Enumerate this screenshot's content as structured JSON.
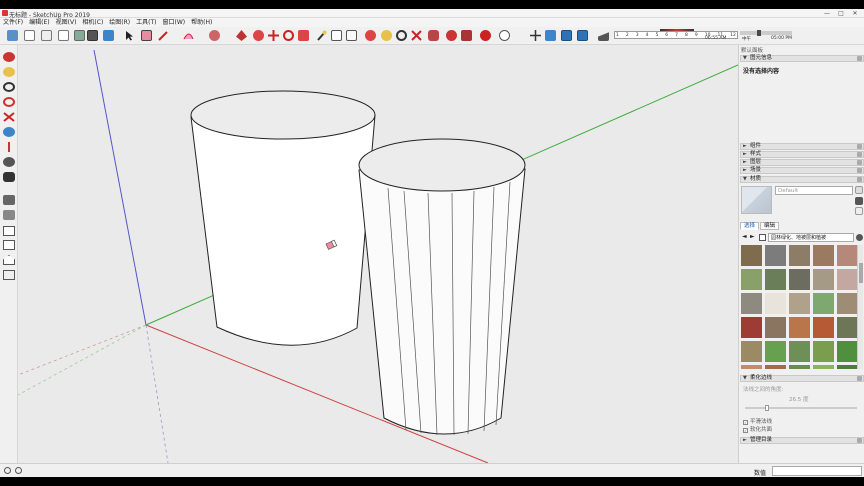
{
  "window": {
    "title": "无标题 - SketchUp Pro 2019",
    "controls": [
      "—",
      "□",
      "✕"
    ]
  },
  "menu": [
    "文件(F)",
    "编辑(E)",
    "视图(V)",
    "相机(C)",
    "绘图(R)",
    "工具(T)",
    "窗口(W)",
    "帮助(H)"
  ],
  "shadow_settings": {
    "months": [
      "1",
      "2",
      "3",
      "4",
      "5",
      "6",
      "7",
      "8",
      "9",
      "10",
      "11",
      "12"
    ],
    "time_start": "06:55 AM",
    "time_noon": "中午",
    "time_end": "05:00 PM"
  },
  "tray": {
    "title": "默认面板",
    "entity_info": {
      "header": "图元信息",
      "none_selected": "没有选择内容"
    },
    "sections": [
      "组件",
      "样式",
      "图层",
      "场景",
      "材质"
    ],
    "materials": {
      "name_placeholder": "Default",
      "tabs": [
        "选择",
        "编辑"
      ],
      "collection": "园林绿化、地被层和植被",
      "swatch_colors": [
        "#7f6b4e",
        "#7c7c7c",
        "#8e7d66",
        "#9b7a62",
        "#b5897a",
        "#8aa06a",
        "#6a7e59",
        "#6c6d60",
        "#a49a86",
        "#c4a7a0",
        "#8e8a80",
        "#e8e4dc",
        "#b0a28a",
        "#7da86f",
        "#9e8c74",
        "#9d3b34",
        "#8a7660",
        "#b8764a",
        "#b55a34",
        "#6d7657",
        "#9b8a63",
        "#67a04f",
        "#6e8f55",
        "#7a9e4e",
        "#4f8f3e",
        "#c48b6a",
        "#a06c4a",
        "#6a8c4d",
        "#8cb35c",
        "#4c7d3a"
      ]
    },
    "soften": {
      "header": "柔化边线",
      "normal_angle_label": "法线之间的角度:",
      "angle_value": "26.5 度",
      "smooth_normals": "平滑法线",
      "soften_coplanar": "软化共面",
      "smooth_checked": true,
      "coplanar_checked": true
    },
    "outliner": {
      "header": "管理目录"
    }
  },
  "status": {
    "measurements_label": "数值",
    "measurements_value": ""
  }
}
